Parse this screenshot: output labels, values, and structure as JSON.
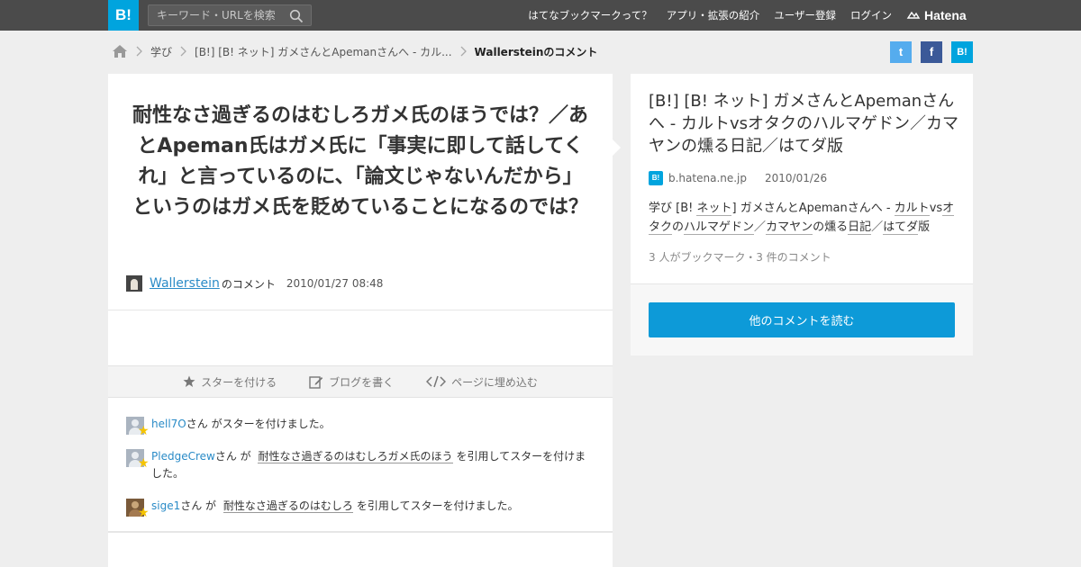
{
  "header": {
    "logo": "B!",
    "search_placeholder": "キーワード・URLを検索",
    "nav": [
      "はてなブックマークって？",
      "アプリ・拡張の紹介",
      "ユーザー登録",
      "ログイン"
    ],
    "brand": "Hatena"
  },
  "breadcrumb": {
    "category": "学び",
    "entry": "[B!] [B! ネット] ガメさんとApemanさんへ - カル...",
    "current": "Wallersteinのコメント"
  },
  "share": {
    "twitter": "t",
    "facebook": "f",
    "hatena": "B!"
  },
  "comment": {
    "text": "耐性なさ過ぎるのはむしろガメ氏のほうでは？／あとApeman氏はガメ氏に「事実に即して話してくれ」と言っているのに、「論文じゃないんだから」というのはガメ氏を貶めていることになるのでは？",
    "user": "Wallerstein",
    "user_suffix": "のコメント",
    "timestamp": "2010/01/27 08:48"
  },
  "actions": {
    "star": "スターを付ける",
    "blog": "ブログを書く",
    "embed": "ページに埋め込む"
  },
  "stars": [
    {
      "user": "hell7O",
      "pre": "さん がスターを付けました。",
      "quote": "",
      "post": ""
    },
    {
      "user": "PledgeCrew",
      "pre": "さん が",
      "quote": "耐性なさ過ぎるのはむしろガメ氏のほう",
      "post": "を引用してスターを付けました。"
    },
    {
      "user": "sige1",
      "pre": "さん が",
      "quote": "耐性なさ過ぎるのはむしろ",
      "post": "を引用してスターを付けました。"
    }
  ],
  "entry": {
    "title": "[B!] [B! ネット] ガメさんとApemanさんへ - カルトvsオタクのハルマゲドン／カマヤンの燻る日記／はてダ版",
    "domain": "b.hatena.ne.jp",
    "date": "2010/01/26",
    "tags_prefix": "学び [B! ",
    "tag1": "ネット",
    "tags_mid": "] ガメさんとApemanさんへ - ",
    "tag2": "カルト",
    "tags_vs": "vs",
    "tag3": "オタク",
    "tags_no": "の",
    "tag4": "ハルマゲドン",
    "tags_slash1": "／",
    "tag5": "カマヤン",
    "tags_no2": "の燻る",
    "tag6": "日記",
    "tags_slash2": "／",
    "tag7": "はてダ",
    "tags_end": "版",
    "counts": "3 人がブックマーク・3 件のコメント",
    "button": "他のコメントを読む"
  },
  "colors": {
    "accent": "#00a4de",
    "link": "#2a8bc7",
    "topbar": "#4b4b4b"
  }
}
